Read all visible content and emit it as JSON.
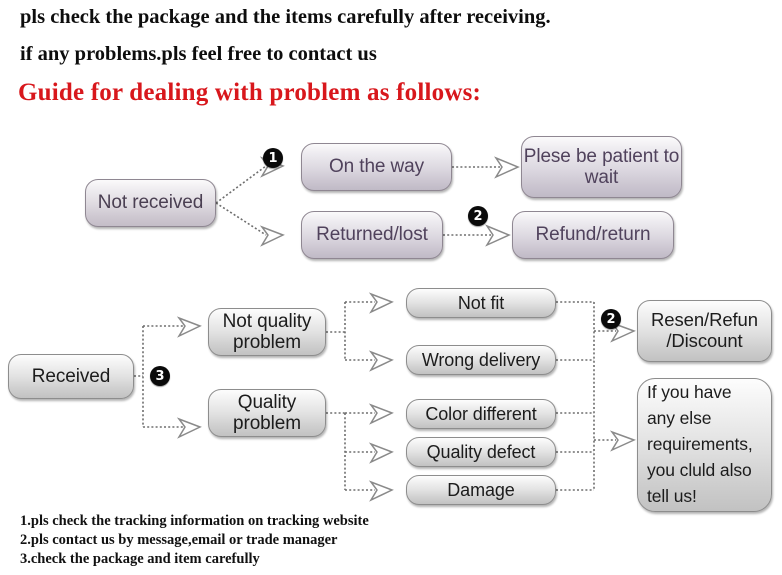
{
  "header": {
    "line1": "pls check the package and the items carefully after receiving.",
    "line2": "if any problems.pls feel free to contact us",
    "guide": "Guide for dealing with problem as follows:",
    "guide_color": "#d8171c"
  },
  "flow_top": {
    "start": "Not received",
    "branches": [
      {
        "label": "On the way",
        "result": "Plese be patient to wait"
      },
      {
        "label": "Returned/lost",
        "result": "Refund/return"
      }
    ],
    "badges": [
      {
        "num": "❶",
        "text": "1"
      },
      {
        "num": "❷",
        "text": "2"
      }
    ]
  },
  "flow_bottom": {
    "start": "Received",
    "badge": {
      "num": "❸",
      "text": "3"
    },
    "badge_right": {
      "num": "❷",
      "text": "2"
    },
    "categories": [
      {
        "label": "Not quality\nproblem",
        "items": [
          "Not fit",
          "Wrong delivery"
        ]
      },
      {
        "label": "Quality\nproblem",
        "items": [
          "Color different",
          "Quality defect",
          "Damage"
        ]
      }
    ],
    "outcomes": [
      "Resen/Refun\n/Discount",
      "If you have\nany else\nrequirements,\nyou cluld also\ntell us!"
    ]
  },
  "footer": {
    "line1": "1.pls check the tracking information on tracking website",
    "line2": "2.pls contact us by message,email or trade manager",
    "line3": "3.check the package and item carefully"
  }
}
